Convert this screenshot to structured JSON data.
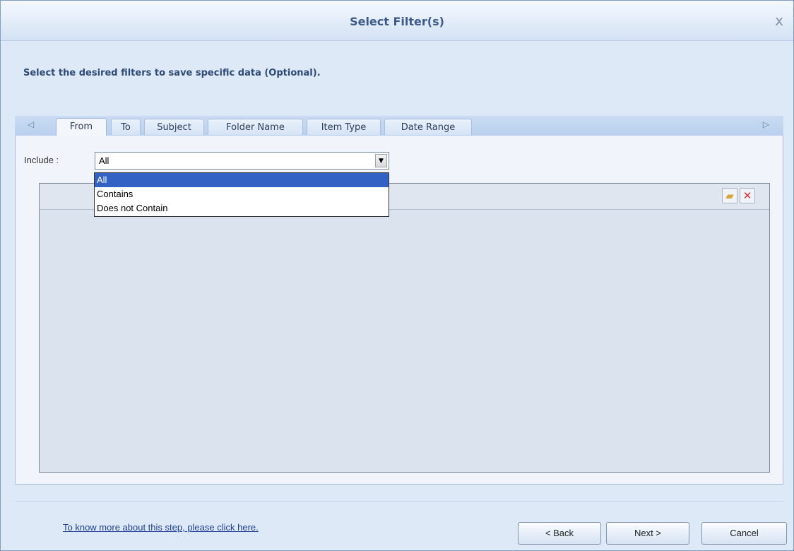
{
  "window": {
    "title": "Select Filter(s)",
    "close_glyph": "x"
  },
  "instruction": "Select the desired filters to save specific data (Optional).",
  "tabs": [
    {
      "label": "From",
      "active": true
    },
    {
      "label": "To",
      "active": false
    },
    {
      "label": "Subject",
      "active": false
    },
    {
      "label": "Folder Name",
      "active": false
    },
    {
      "label": "Item Type",
      "active": false
    },
    {
      "label": "Date Range",
      "active": false
    }
  ],
  "include": {
    "label": "Include :",
    "selected": "All",
    "options": [
      "All",
      "Contains",
      "Does not Contain"
    ]
  },
  "grid_toolbar": {
    "icons": [
      "folder-icon",
      "delete-icon"
    ]
  },
  "footer": {
    "help_link": "To know more about this step, please click here.",
    "back_label": "< Back",
    "next_label": "Next >",
    "cancel_label": "Cancel"
  }
}
